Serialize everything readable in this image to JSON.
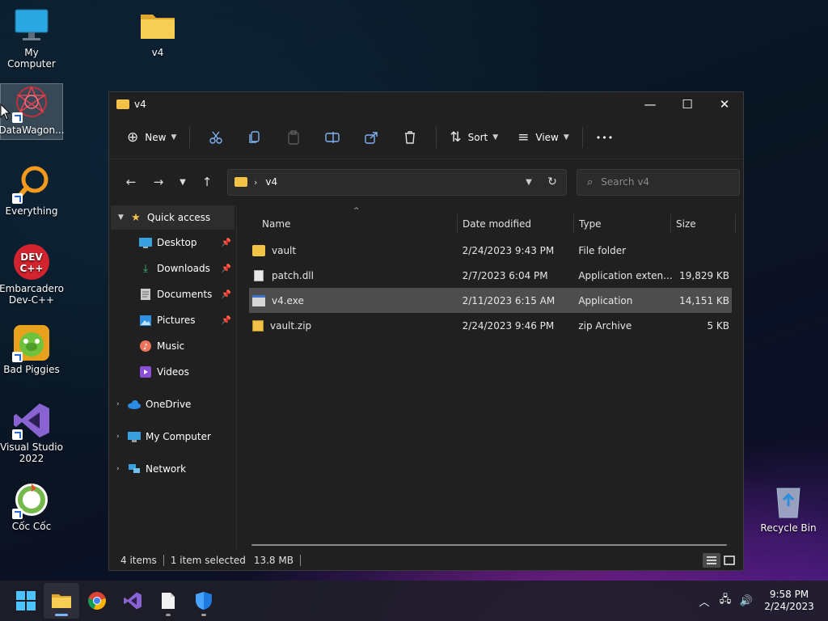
{
  "desktop": {
    "icons": [
      {
        "label": "My Computer"
      },
      {
        "label": "v4"
      },
      {
        "label": "DataWagon..."
      },
      {
        "label": "Everything"
      },
      {
        "label": "Embarcadero Dev-C++"
      },
      {
        "label": "Bad Piggies"
      },
      {
        "label": "Visual Studio 2022"
      },
      {
        "label": "Cốc Cốc"
      },
      {
        "label": "Recycle Bin"
      }
    ]
  },
  "window": {
    "title": "v4",
    "controls": {
      "minimize": "—",
      "maximize": "☐",
      "close": "✕"
    }
  },
  "toolbar": {
    "new_label": "New",
    "sort_label": "Sort",
    "view_label": "View",
    "more_label": "•••"
  },
  "address": {
    "path": "v4",
    "search_placeholder": "Search v4"
  },
  "navigation": {
    "quick_access": "Quick access",
    "items": [
      {
        "label": "Desktop"
      },
      {
        "label": "Downloads"
      },
      {
        "label": "Documents"
      },
      {
        "label": "Pictures"
      },
      {
        "label": "Music"
      },
      {
        "label": "Videos"
      }
    ],
    "onedrive": "OneDrive",
    "my_computer": "My Computer",
    "network": "Network"
  },
  "columns": {
    "name": "Name",
    "date": "Date modified",
    "type": "Type",
    "size": "Size"
  },
  "files": [
    {
      "name": "vault",
      "date": "2/24/2023 9:43 PM",
      "type": "File folder",
      "size": ""
    },
    {
      "name": "patch.dll",
      "date": "2/7/2023 6:04 PM",
      "type": "Application exten...",
      "size": "19,829 KB"
    },
    {
      "name": "v4.exe",
      "date": "2/11/2023 6:15 AM",
      "type": "Application",
      "size": "14,151 KB"
    },
    {
      "name": "vault.zip",
      "date": "2/24/2023 9:46 PM",
      "type": "zip Archive",
      "size": "5 KB"
    }
  ],
  "status": {
    "items": "4 items",
    "selected": "1 item selected",
    "size": "13.8 MB"
  },
  "taskbar": {
    "time": "9:58 PM",
    "date": "2/24/2023"
  },
  "colors": {
    "folder": "#f2c246",
    "accent": "#7db3ff",
    "window_bg": "#202020",
    "selected_row": "#4d4d4d"
  }
}
